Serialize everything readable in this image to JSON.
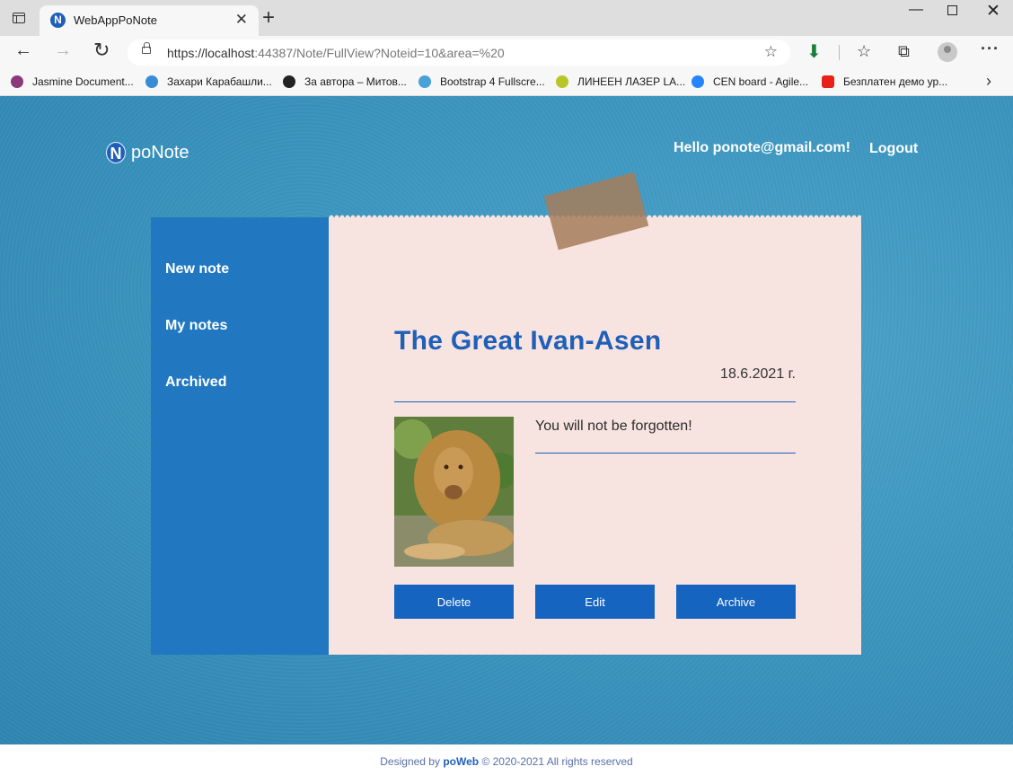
{
  "browser": {
    "tab_title": "WebAppPoNote",
    "tab_favicon_letter": "N",
    "url_host": "https://localhost",
    "url_rest": ":44387/Note/FullView?Noteid=10&area=%20",
    "bookmarks": [
      {
        "label": "Jasmine Document...",
        "icon": "jasmine-icon",
        "color": "#8a3a7a"
      },
      {
        "label": "Захари Карабашли...",
        "icon": "globe-icon",
        "color": "#3a8ad6"
      },
      {
        "label": "За автора – Митов...",
        "icon": "wordpress-icon",
        "color": "#222222"
      },
      {
        "label": "Bootstrap 4 Fullscre...",
        "icon": "cloud-icon",
        "color": "#4aa0d8"
      },
      {
        "label": "ЛИНЕЕН ЛАЗЕР LA...",
        "icon": "p-icon",
        "color": "#b8c62a"
      },
      {
        "label": "CEN board - Agile...",
        "icon": "jira-icon",
        "color": "#2684ff"
      },
      {
        "label": "Безплатен демо ур...",
        "icon": "youtube-icon",
        "color": "#e62117"
      }
    ]
  },
  "site": {
    "brand_letter": "N",
    "brand_name": "poNote",
    "greeting": "Hello ponote@gmail.com!",
    "logout": "Logout"
  },
  "sidebar": {
    "items": [
      {
        "label": "New note"
      },
      {
        "label": "My notes"
      },
      {
        "label": "Archived"
      }
    ]
  },
  "note": {
    "title": "The Great Ivan-Asen",
    "date": "18.6.2021 г.",
    "text": "You will not be forgotten!",
    "image": "lion-photo"
  },
  "actions": {
    "delete": "Delete",
    "edit": "Edit",
    "archive": "Archive"
  },
  "footer": {
    "prefix": "Designed by",
    "brand": "poWeb",
    "suffix": "© 2020-2021 All rights reserved"
  },
  "colors": {
    "accent": "#1f5fb8",
    "button": "#1564c0",
    "sidebar": "#2178c1",
    "note_paper": "#f7e4e0",
    "background": "#3d98c2"
  }
}
